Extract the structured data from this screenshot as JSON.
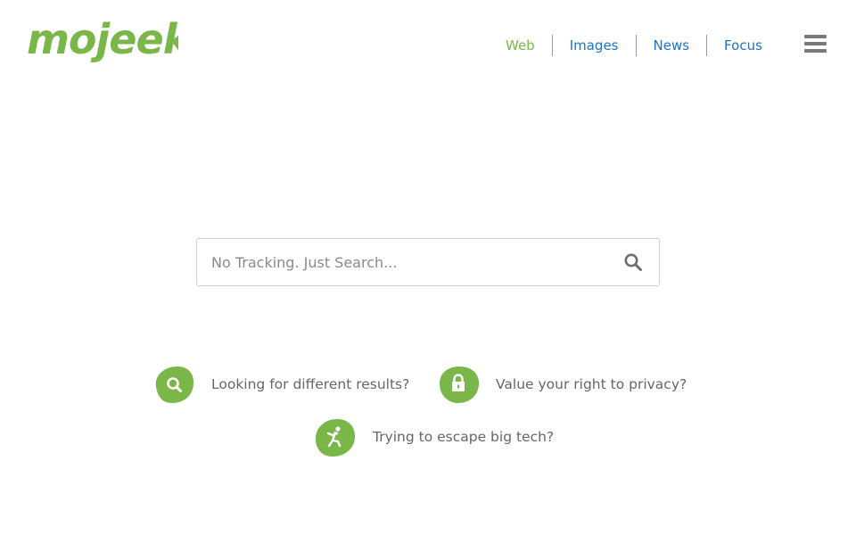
{
  "brand": {
    "logo_text": "mojeek",
    "color": "#7ab648"
  },
  "nav": {
    "items": [
      {
        "label": "Web",
        "active": true
      },
      {
        "label": "Images",
        "active": false
      },
      {
        "label": "News",
        "active": false
      },
      {
        "label": "Focus",
        "active": false
      }
    ],
    "link_color": "#1a73c8",
    "menu_icon": "hamburger-icon"
  },
  "search": {
    "placeholder": "No Tracking. Just Search...",
    "value": "",
    "button_icon": "search-icon"
  },
  "features": [
    {
      "label": "Looking for different results?",
      "icon": "search-icon"
    },
    {
      "label": "Value your right to privacy?",
      "icon": "lock-icon"
    },
    {
      "label": "Trying to escape big tech?",
      "icon": "escape-figure-icon"
    }
  ]
}
